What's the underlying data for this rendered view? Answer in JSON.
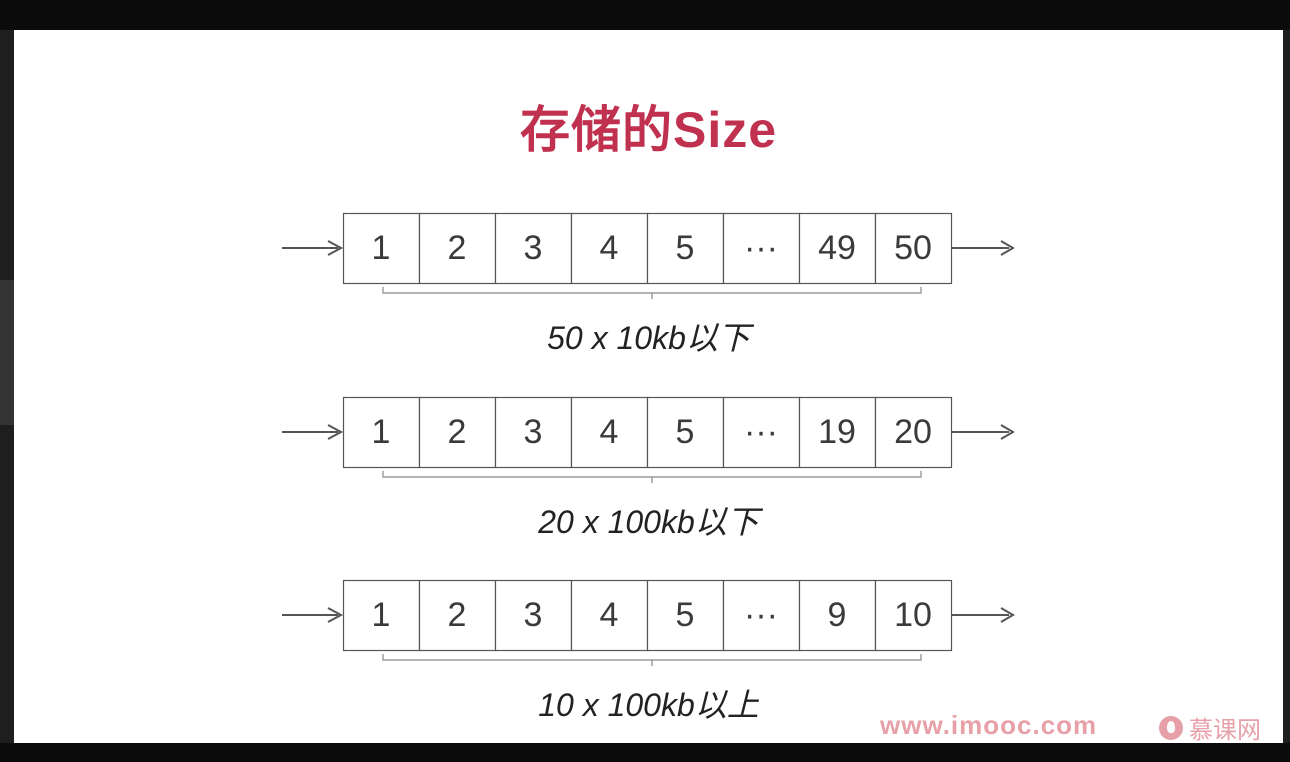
{
  "slide": {
    "title": "存储的Size",
    "rows": [
      {
        "cells": [
          "1",
          "2",
          "3",
          "4",
          "5",
          "···",
          "49",
          "50"
        ],
        "caption": "50 x 10kb以下"
      },
      {
        "cells": [
          "1",
          "2",
          "3",
          "4",
          "5",
          "···",
          "19",
          "20"
        ],
        "caption": "20 x 100kb以下"
      },
      {
        "cells": [
          "1",
          "2",
          "3",
          "4",
          "5",
          "···",
          "9",
          "10"
        ],
        "caption": "10 x 100kb以上"
      }
    ]
  },
  "watermark": {
    "site": "www.imooc.com",
    "brand": "慕课网"
  },
  "colors": {
    "title": "#c0314f",
    "watermark": "#e7a0a8",
    "cell_border": "#555555"
  }
}
